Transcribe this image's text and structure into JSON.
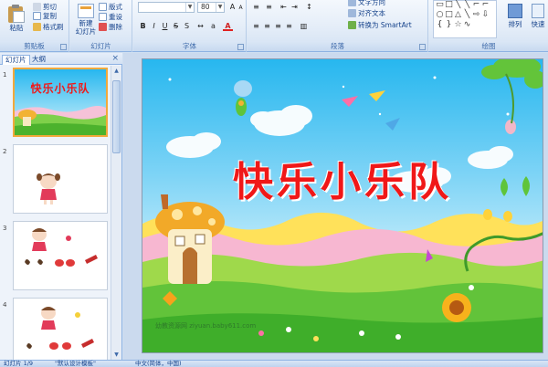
{
  "ribbon": {
    "clipboard": {
      "paste_label": "粘贴",
      "copy_label": "复制",
      "format_painter_label": "格式刷",
      "group_label": "剪贴板"
    },
    "slides": {
      "new_slide_label": "新建\n幻灯片",
      "reset_label": "重设",
      "layout_label": "版式",
      "delete_label": "删除",
      "group_label": "幻灯片"
    },
    "font": {
      "font_size_value": "80",
      "group_label": "字体"
    },
    "paragraph": {
      "text_direction_label": "文字方向",
      "align_text_label": "对齐文本",
      "smartart_label": "转换为 SmartArt",
      "group_label": "段落"
    },
    "drawing": {
      "arrange_label": "排列",
      "quick_styles_label": "快速",
      "group_label": "绘图"
    }
  },
  "pane": {
    "tab_slides": "幻灯片",
    "tab_outline": "大纲",
    "close_glyph": "×",
    "thumbs": [
      {
        "num": "1",
        "title": "快乐小乐队"
      },
      {
        "num": "2"
      },
      {
        "num": "3"
      },
      {
        "num": "4"
      }
    ]
  },
  "slide": {
    "title": "快乐小乐队",
    "watermark": "幼教资源网 ziyuan.baby611.com"
  },
  "status": {
    "slide_info": "幻灯片 1/9",
    "theme": "\"默认设计模板\"",
    "language": "中文(简体，中国)"
  },
  "colors": {
    "ribbon_bg": "#dfe9f5",
    "accent": "#15428b",
    "title_red": "#f01818",
    "sky": "#27b7ef",
    "grass": "#5fc43a"
  }
}
